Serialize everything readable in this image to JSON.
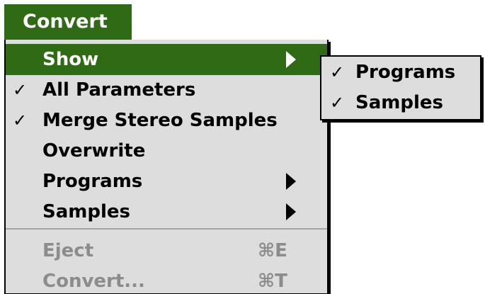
{
  "menu_bar": {
    "title": "Convert"
  },
  "menu": {
    "items": [
      {
        "label": "Show",
        "checked": "",
        "has_submenu": true,
        "highlighted": true,
        "enabled": true
      },
      {
        "label": "All Parameters",
        "checked": "✓",
        "has_submenu": false,
        "enabled": true
      },
      {
        "label": "Merge Stereo Samples",
        "checked": "✓",
        "has_submenu": false,
        "enabled": true
      },
      {
        "label": "Overwrite",
        "checked": "",
        "has_submenu": false,
        "enabled": true
      },
      {
        "label": "Programs",
        "checked": "",
        "has_submenu": true,
        "enabled": true
      },
      {
        "label": "Samples",
        "checked": "",
        "has_submenu": true,
        "enabled": true
      },
      {
        "label": "Eject",
        "shortcut": "⌘E",
        "enabled": false
      },
      {
        "label": "Convert...",
        "shortcut": "⌘T",
        "enabled": false
      }
    ]
  },
  "submenu": {
    "items": [
      {
        "label": "Programs",
        "checked": "✓"
      },
      {
        "label": "Samples",
        "checked": "✓"
      }
    ]
  },
  "colors": {
    "highlight": "#2f6a14",
    "menu_background": "#dddddd",
    "disabled_text": "#8c8c8c"
  },
  "icons": {
    "submenu_arrow": "triangle-right-icon",
    "checkmark": "checkmark-icon",
    "command_key": "command-key-icon"
  }
}
